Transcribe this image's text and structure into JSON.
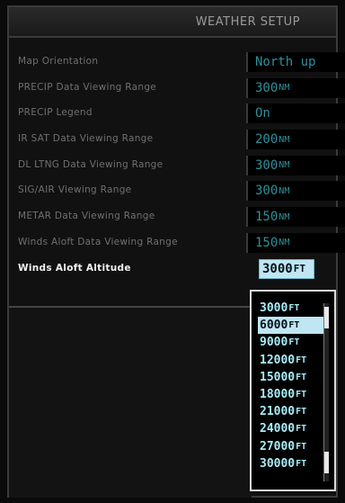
{
  "header": {
    "title": "WEATHER SETUP"
  },
  "settings": [
    {
      "label": "Map Orientation",
      "value": "North up",
      "unit": ""
    },
    {
      "label": "PRECIP Data Viewing Range",
      "value": "300",
      "unit": "NM"
    },
    {
      "label": "PRECIP Legend",
      "value": "On",
      "unit": ""
    },
    {
      "label": "IR SAT Data Viewing Range",
      "value": "200",
      "unit": "NM"
    },
    {
      "label": "DL LTNG Data Viewing Range",
      "value": "300",
      "unit": "NM"
    },
    {
      "label": "SIG/AIR Viewing Range",
      "value": "300",
      "unit": "NM"
    },
    {
      "label": "METAR Data Viewing Range",
      "value": "150",
      "unit": "NM"
    },
    {
      "label": "Winds Aloft Data Viewing Range",
      "value": "150",
      "unit": "NM"
    },
    {
      "label": "Winds Aloft Altitude",
      "value": "3000",
      "unit": "FT"
    }
  ],
  "altitude_dropdown": {
    "options": [
      {
        "value": "3000",
        "unit": "FT"
      },
      {
        "value": "6000",
        "unit": "FT"
      },
      {
        "value": "9000",
        "unit": "FT"
      },
      {
        "value": "12000",
        "unit": "FT"
      },
      {
        "value": "15000",
        "unit": "FT"
      },
      {
        "value": "18000",
        "unit": "FT"
      },
      {
        "value": "21000",
        "unit": "FT"
      },
      {
        "value": "24000",
        "unit": "FT"
      },
      {
        "value": "27000",
        "unit": "FT"
      },
      {
        "value": "30000",
        "unit": "FT"
      }
    ],
    "selected_index": 1
  },
  "colors": {
    "value_text": "#2f8f9a",
    "highlight": "#bfe6f2",
    "option_text": "#a9ecf7"
  }
}
